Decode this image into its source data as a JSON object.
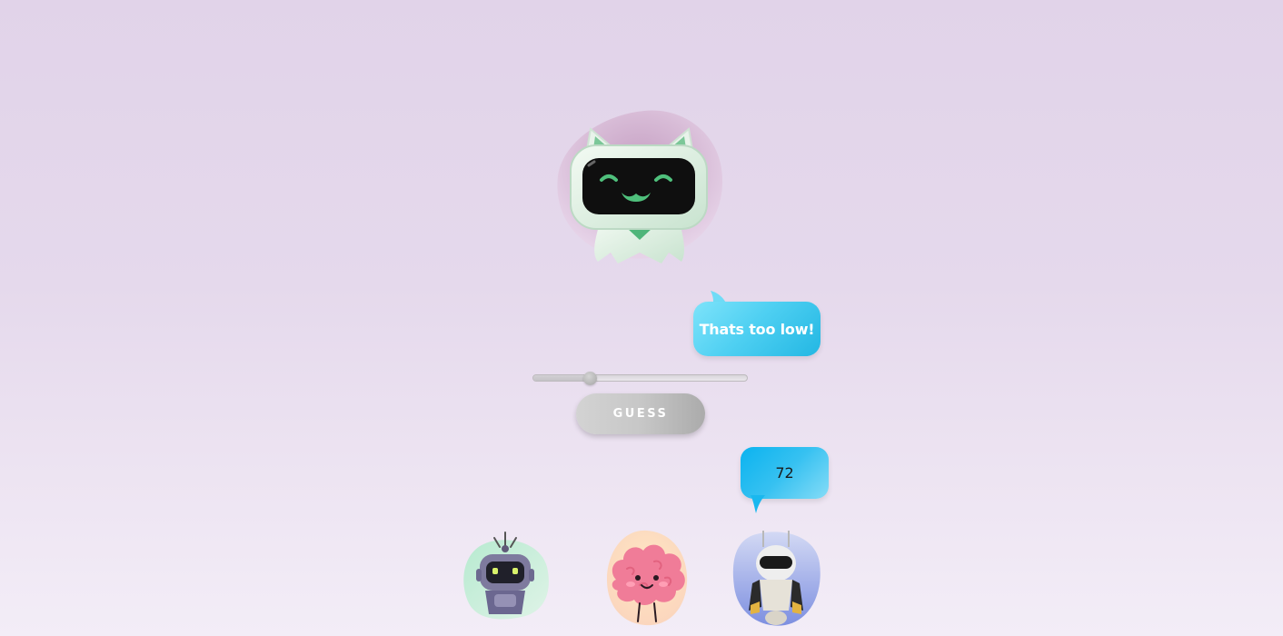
{
  "host": {
    "name": "cat-robot-host",
    "speech": "Thats too low!"
  },
  "slider": {
    "value_fraction": 0.26
  },
  "guess_button": {
    "label": "GUESS"
  },
  "player_guess": {
    "value": "72"
  },
  "players": [
    {
      "name": "purple-robot"
    },
    {
      "name": "pink-brain"
    },
    {
      "name": "white-android"
    }
  ],
  "colors": {
    "background": "#e3d6eb",
    "host_bubble": "#4fd0f2",
    "guess_bubble": "#22bbef",
    "button": "#c4c4c4"
  }
}
